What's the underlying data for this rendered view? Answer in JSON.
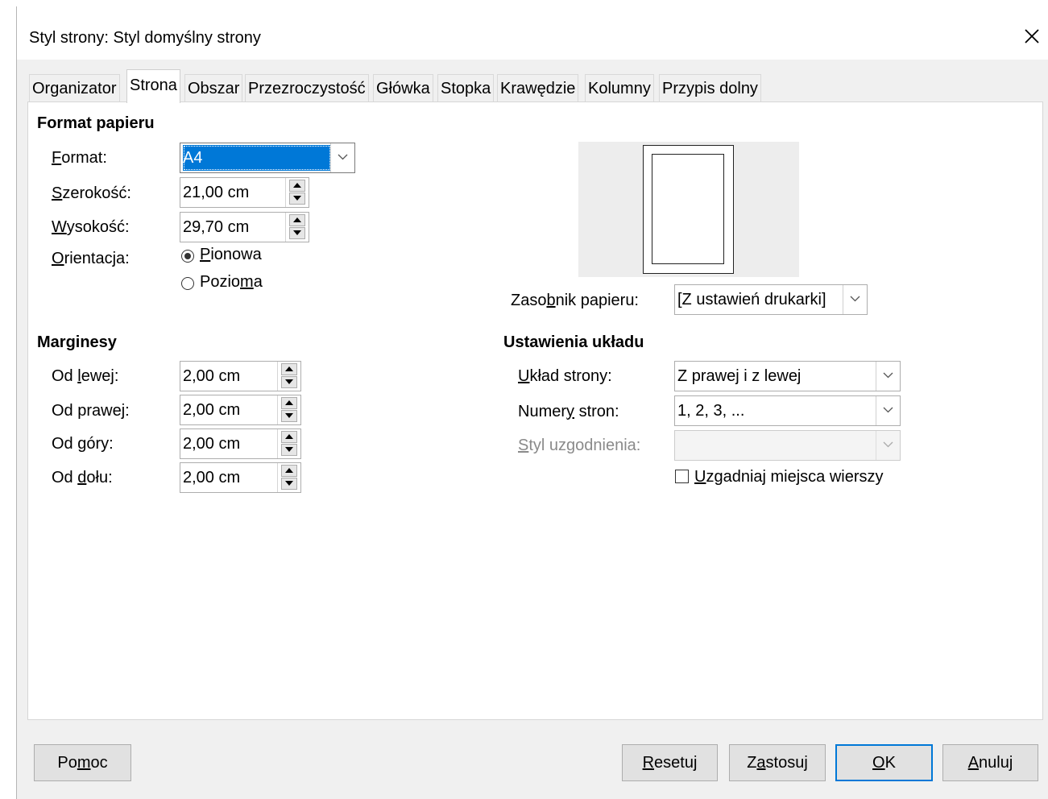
{
  "window": {
    "title": "Styl strony: Styl domyślny strony",
    "close_icon": "close-icon"
  },
  "tabs": [
    {
      "label": "Organizator"
    },
    {
      "label": "Strona",
      "active": true
    },
    {
      "label": "Obszar"
    },
    {
      "label": "Przezroczystość"
    },
    {
      "label": "Główka"
    },
    {
      "label": "Stopka"
    },
    {
      "label": "Krawędzie"
    },
    {
      "label": "Kolumny"
    },
    {
      "label": "Przypis dolny"
    }
  ],
  "paper_format": {
    "heading": "Format papieru",
    "format_label": "Format:",
    "format_value": "A4",
    "width_label": "Szerokość:",
    "width_value": "21,00 cm",
    "height_label": "Wysokość:",
    "height_value": "29,70 cm",
    "orientation_label": "Orientacja:",
    "portrait_label": "Pionowa",
    "landscape_label": "Pozioma",
    "orientation_selected": "Pionowa"
  },
  "paper_tray": {
    "label": "Zasobnik papieru:",
    "value": "[Z ustawień drukarki]"
  },
  "margins": {
    "heading": "Marginesy",
    "left_label": "Od lewej:",
    "left_value": "2,00 cm",
    "right_label": "Od prawej:",
    "right_value": "2,00 cm",
    "top_label": "Od góry:",
    "top_value": "2,00 cm",
    "bottom_label": "Od dołu:",
    "bottom_value": "2,00 cm"
  },
  "layout_settings": {
    "heading": "Ustawienia układu",
    "page_layout_label": "Układ strony:",
    "page_layout_value": "Z prawej i z lewej",
    "page_numbers_label": "Numery stron:",
    "page_numbers_value": "1, 2, 3, ...",
    "register_style_label": "Styl uzgodnienia:",
    "register_style_value": "",
    "register_true_label": "Uzgadniaj miejsca wierszy",
    "register_true_checked": false
  },
  "buttons": {
    "help": "Pomoc",
    "reset": "Resetuj",
    "apply": "Zastosuj",
    "ok": "OK",
    "cancel": "Anuluj"
  },
  "colors": {
    "selection": "#0078d7",
    "accent_border": "#0078d7"
  }
}
